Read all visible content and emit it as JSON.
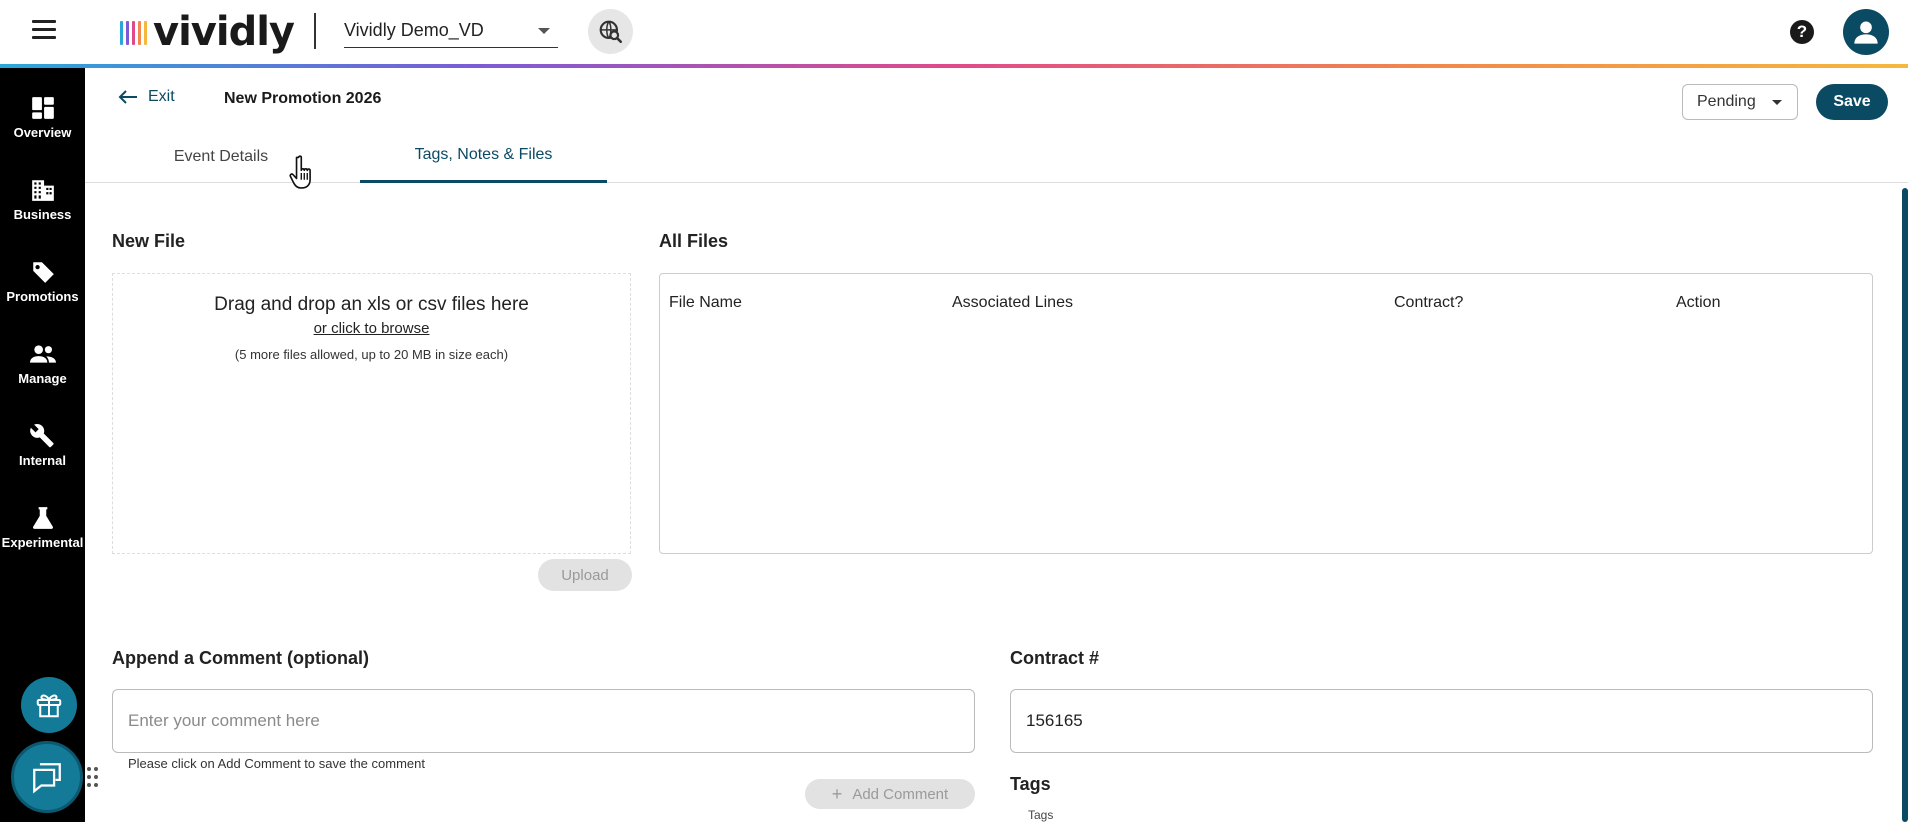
{
  "header": {
    "logo_text": "vividly",
    "org_select": "Vividly Demo_VD"
  },
  "sidebar": {
    "items": [
      {
        "label": "Overview",
        "icon": "dashboard-icon"
      },
      {
        "label": "Business",
        "icon": "building-icon"
      },
      {
        "label": "Promotions",
        "icon": "tag-icon"
      },
      {
        "label": "Manage",
        "icon": "people-icon"
      },
      {
        "label": "Internal",
        "icon": "wrench-icon"
      },
      {
        "label": "Experimental",
        "icon": "flask-icon"
      }
    ]
  },
  "page": {
    "exit_label": "Exit",
    "title": "New Promotion 2026",
    "status": "Pending",
    "save_label": "Save"
  },
  "tabs": [
    {
      "label": "Event Details",
      "active": false
    },
    {
      "label": "Tags, Notes & Files",
      "active": true
    }
  ],
  "new_file": {
    "heading": "New File",
    "drop_text": "Drag and drop an xls or csv files here",
    "browse_text": "or click to browse",
    "limit_note": "(5 more files allowed, up to 20 MB in size each)",
    "upload_label": "Upload"
  },
  "all_files": {
    "heading": "All Files",
    "columns": [
      "File Name",
      "Associated Lines",
      "Contract?",
      "Action"
    ]
  },
  "comment": {
    "heading": "Append a Comment (optional)",
    "placeholder": "Enter your comment here",
    "helper": "Please click on Add Comment to save the comment",
    "add_label": "Add Comment"
  },
  "contract": {
    "heading": "Contract #",
    "value": "156165"
  },
  "tags": {
    "heading": "Tags",
    "field_label": "Tags"
  },
  "colors": {
    "brand": "#0a4a63",
    "sidebar_bg": "#000000",
    "fab": "#137a98"
  }
}
